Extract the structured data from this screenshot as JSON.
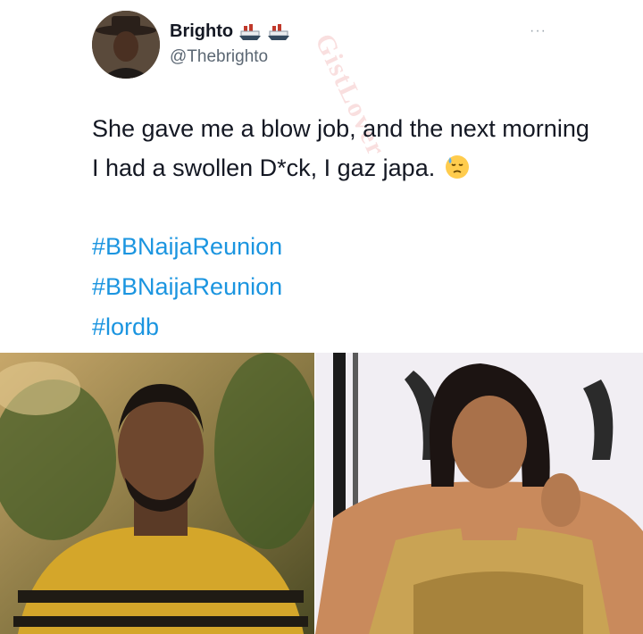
{
  "user": {
    "display_name": "Brighto",
    "handle": "@Thebrighto",
    "badges": [
      "ship-emoji",
      "ship-emoji"
    ]
  },
  "more_menu": "···",
  "tweet": {
    "text": "She gave me a blow job, and the next morning I had a swollen D*ck, I gaz japa.",
    "emoji": "downcast-face-with-sweat-emoji",
    "hashtags": [
      "#BBNaijaReunion",
      "#BBNaijaReunion",
      "#lordb"
    ]
  },
  "watermark": "GistLover",
  "colors": {
    "hashtag": "#1b95e0",
    "text": "#141823",
    "handle": "#5b6773"
  },
  "media": [
    {
      "subject": "man-in-yellow-striped-sweater-photo"
    },
    {
      "subject": "woman-in-gold-embellished-dress-photo"
    }
  ]
}
